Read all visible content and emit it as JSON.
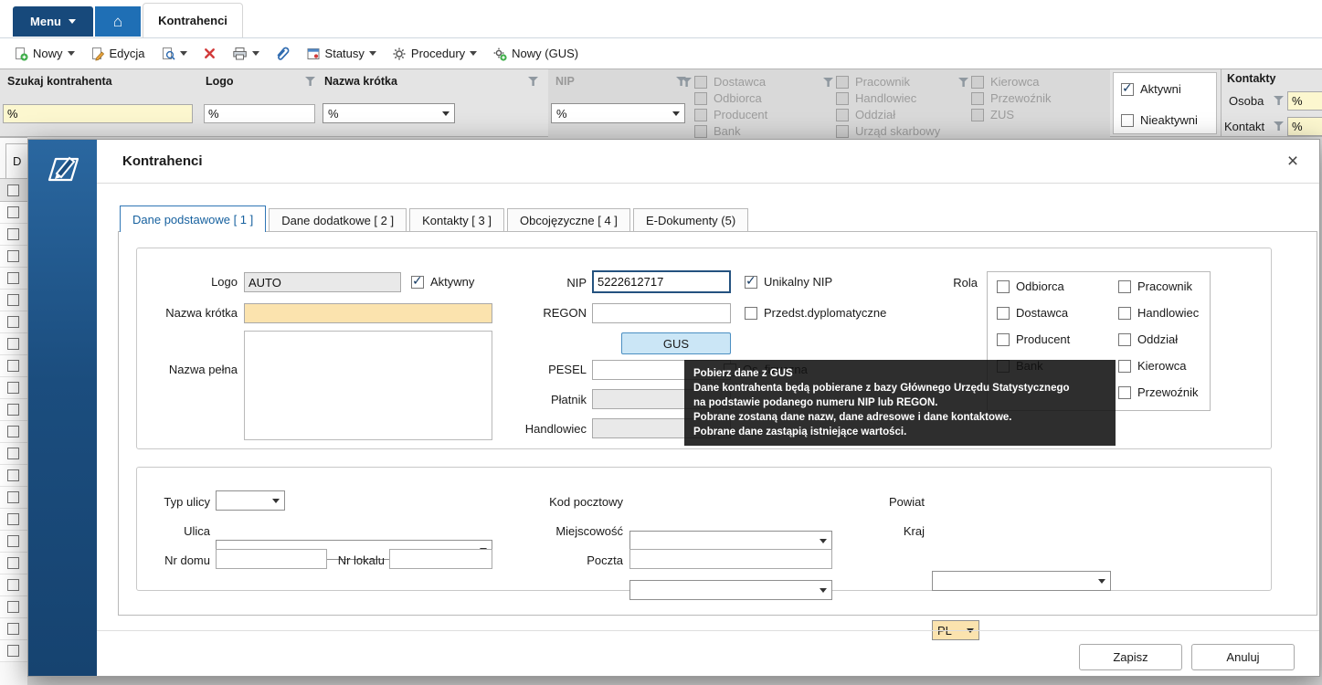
{
  "colors": {
    "menu_navy": "#17497b",
    "home_blue": "#1f6fb5",
    "sidebar_blue": "#1b4d7e",
    "active_tab_blue": "#2f76b5",
    "filter_yellow": "#fcf7cf",
    "required_orange": "#fbe3ae",
    "gus_button_bg": "#cbe6f6",
    "tooltip_bg": "#111111",
    "delete_red": "#d23b3b",
    "new_green": "#3fae4a"
  },
  "icons": {
    "home": "⌂",
    "close": "×",
    "check": "✓"
  },
  "topbar": {
    "menu": "Menu",
    "active_tab": "Kontrahenci"
  },
  "toolbar": {
    "nowy": "Nowy",
    "edycja": "Edycja",
    "statusy": "Statusy",
    "procedury": "Procedury",
    "nowy_gus": "Nowy (GUS)"
  },
  "filter_panel": {
    "szukaj": {
      "label": "Szukaj kontrahenta",
      "value": "%"
    },
    "logo": {
      "label": "Logo",
      "value": "%"
    },
    "nazwa_krotka": {
      "label": "Nazwa krótka",
      "value": "%"
    },
    "nip": {
      "label": "NIP",
      "value": "%"
    },
    "role_columns": [
      [
        "Dostawca",
        "Odbiorca",
        "Producent",
        "Bank"
      ],
      [
        "Pracownik",
        "Handlowiec",
        "Oddział",
        "Urząd skarbowy"
      ],
      [
        "Kierowca",
        "Przewoźnik",
        "ZUS"
      ]
    ],
    "aktywni": "Aktywni",
    "nieaktywni": "Nieaktywni",
    "kontakty": {
      "header": "Kontakty",
      "osoba_label": "Osoba",
      "osoba_value": "%",
      "kontakt_label": "Kontakt",
      "kontakt_value": "%"
    }
  },
  "background_grid": {
    "partial_tab": "D"
  },
  "dialog": {
    "title": "Kontrahenci",
    "tabs": [
      "Dane podstawowe [ 1 ]",
      "Dane dodatkowe [ 2 ]",
      "Kontakty [ 3 ]",
      "Obcojęzyczne [ 4 ]",
      "E-Dokumenty (5)"
    ],
    "main": {
      "logo_label": "Logo",
      "logo_value": "AUTO",
      "aktywny_label": "Aktywny",
      "nazwa_krotka_label": "Nazwa krótka",
      "nazwa_krotka_value": "",
      "nazwa_pelna_label": "Nazwa pełna",
      "nazwa_pelna_value": "",
      "nip_label": "NIP",
      "nip_value": "5222612717",
      "unikalny_nip_label": "Unikalny NIP",
      "regon_label": "REGON",
      "regon_value": "",
      "przedst_label": "Przedst.dyplomatyczne",
      "gus_button": "GUS",
      "pesel_label": "PESEL",
      "pesel_value": "",
      "os_fizyczna_label": "Os. fizyczna",
      "platnik_label": "Płatnik",
      "platnik_value": "",
      "handlowiec_label": "Handlowiec",
      "handlowiec_value": "",
      "rola_label": "Rola",
      "rola_col1": [
        "Odbiorca",
        "Dostawca",
        "Producent",
        "Bank"
      ],
      "rola_col2": [
        "Pracownik",
        "Handlowiec",
        "Oddział",
        "Kierowca",
        "Przewoźnik"
      ]
    },
    "tooltip": {
      "title": "Pobierz dane z GUS",
      "lines": [
        "Dane kontrahenta będą pobierane z bazy Głównego Urzędu Statystycznego",
        "na podstawie podanego numeru NIP lub REGON.",
        "Pobrane zostaną dane nazw, dane adresowe i dane kontaktowe.",
        "Pobrane dane zastąpią istniejące wartości."
      ]
    },
    "address": {
      "typ_ulicy_label": "Typ ulicy",
      "ulica_label": "Ulica",
      "nr_domu_label": "Nr domu",
      "nr_lokalu_label": "Nr lokalu",
      "kod_pocztowy_label": "Kod pocztowy",
      "miejscowosc_label": "Miejscowość",
      "poczta_label": "Poczta",
      "powiat_label": "Powiat",
      "kraj_label": "Kraj",
      "kraj_value": "PL"
    },
    "footer": {
      "zapisz": "Zapisz",
      "anuluj": "Anuluj"
    }
  }
}
